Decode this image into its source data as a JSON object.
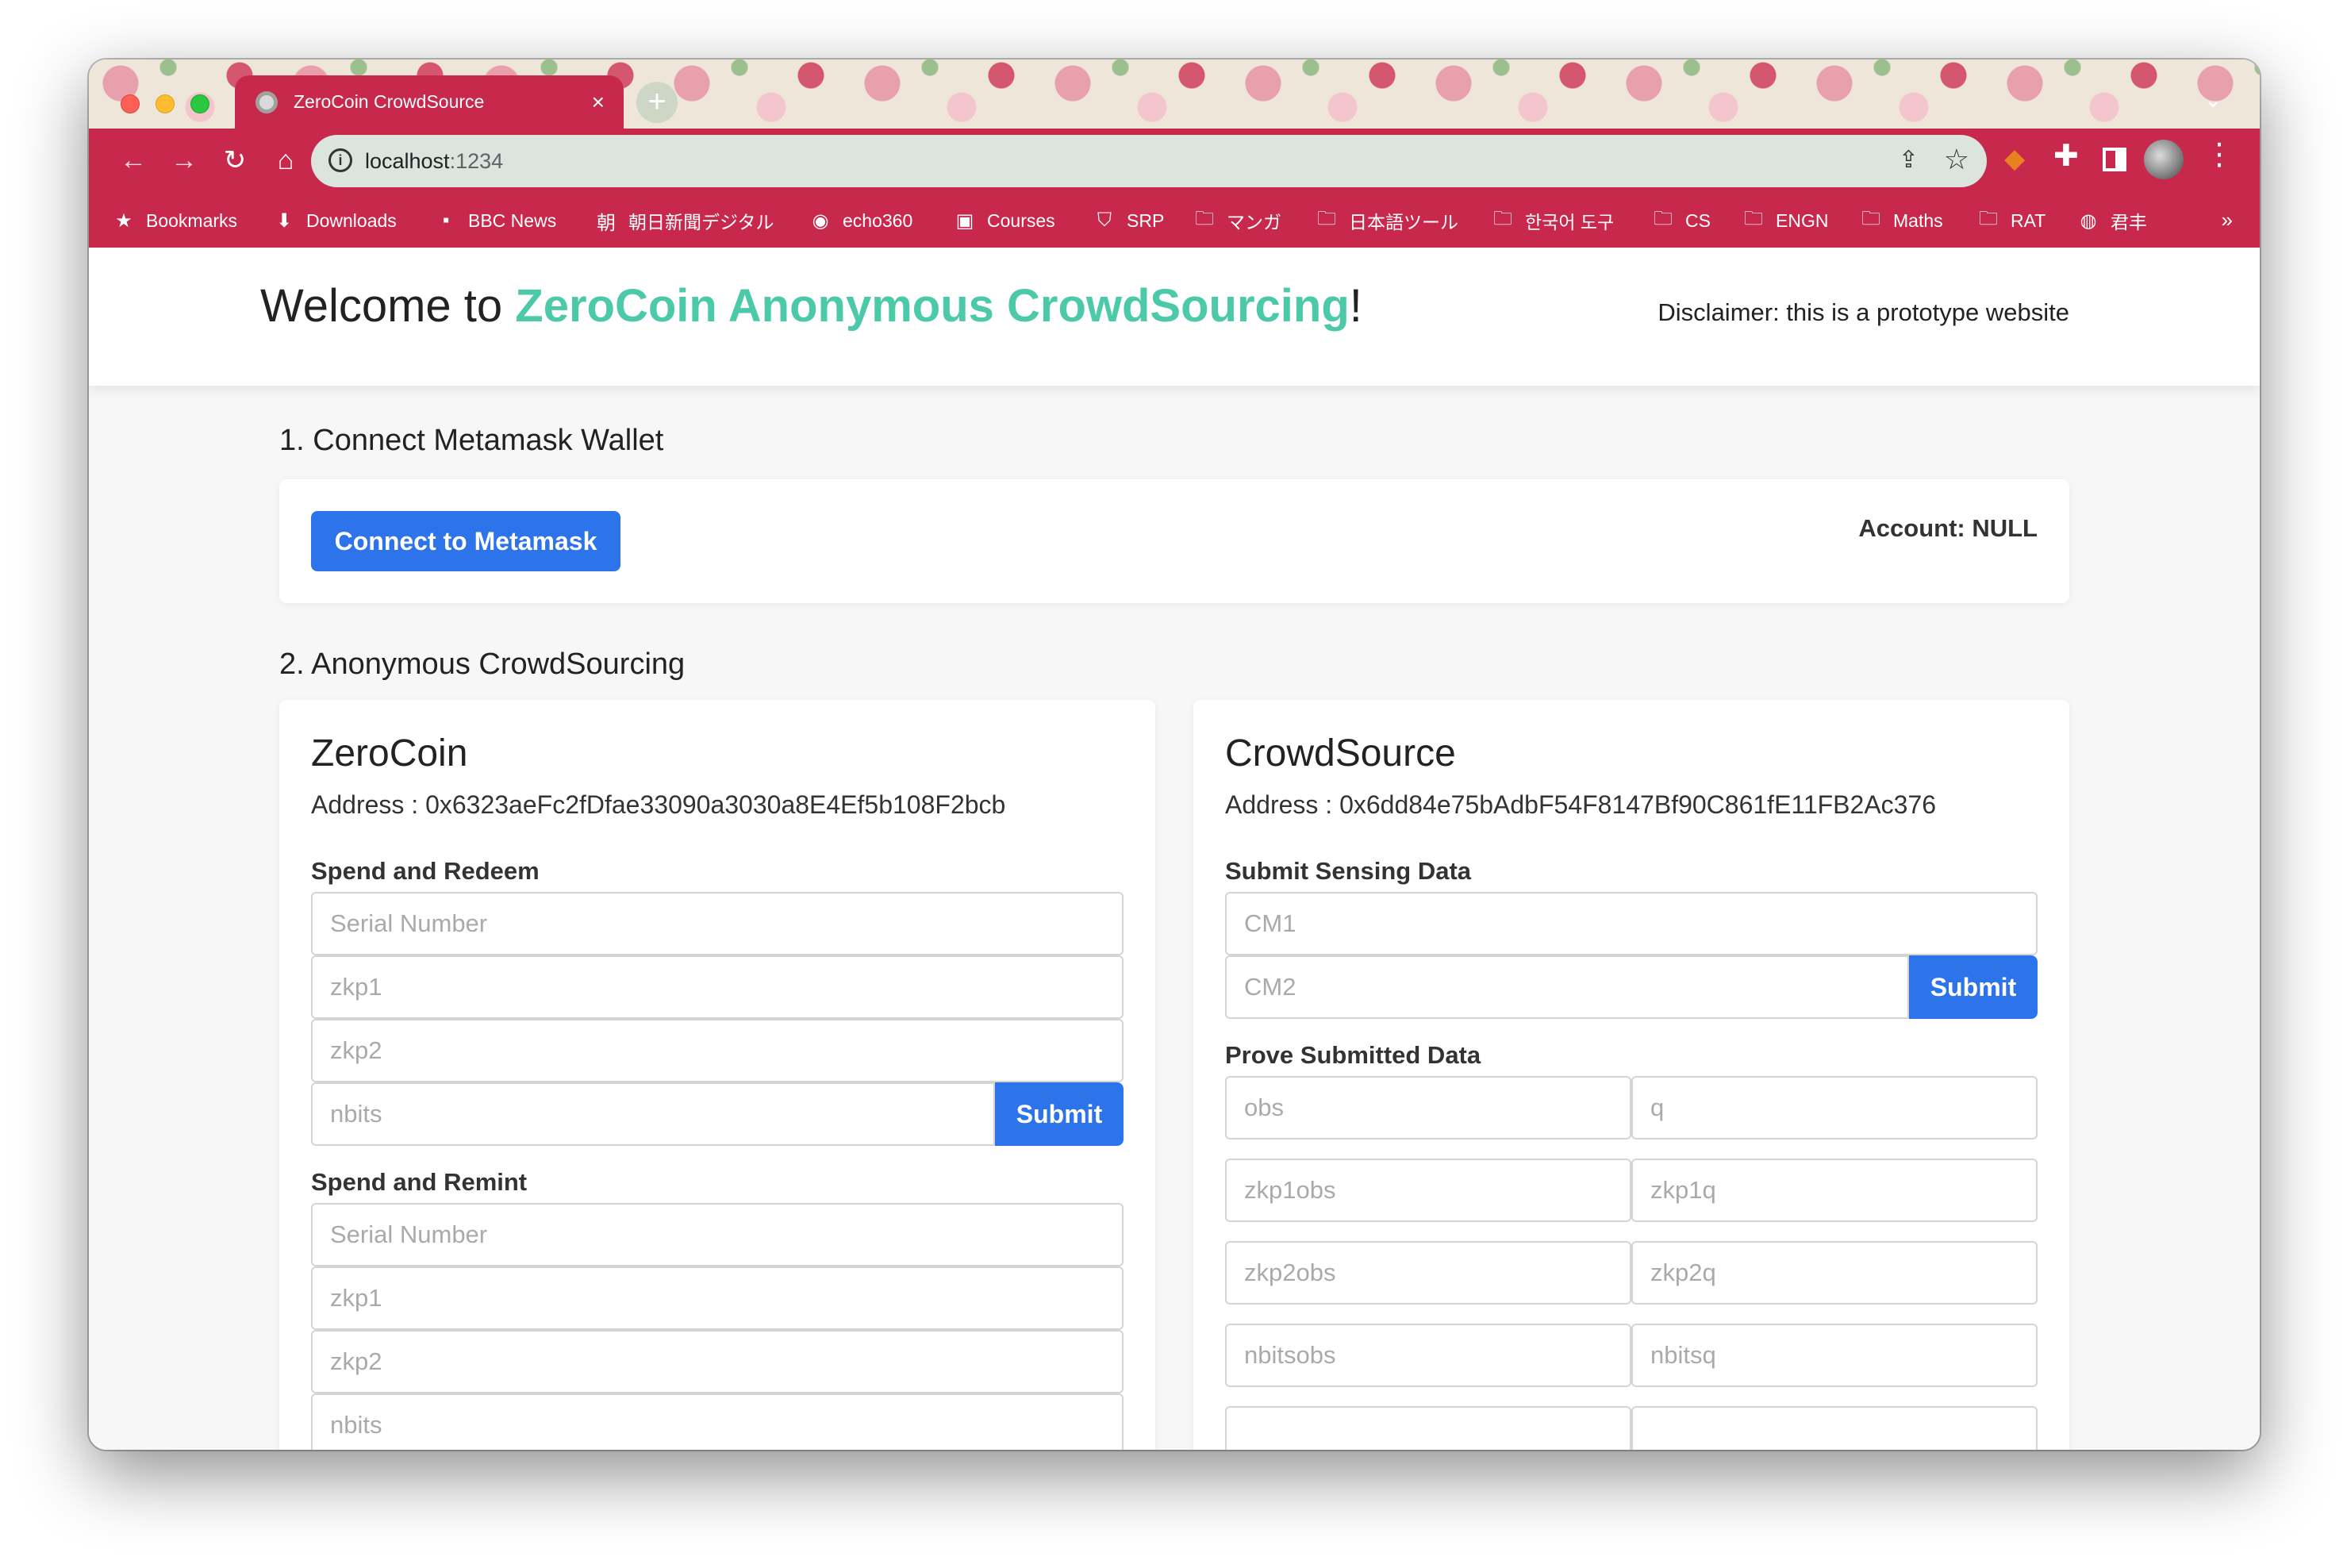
{
  "browser": {
    "tab_title": "ZeroCoin CrowdSource",
    "tab_close": "×",
    "new_tab": "+",
    "url_host": "localhost",
    "url_port": ":1234",
    "more_tabs": "⌄",
    "bookmarks": [
      {
        "label": "Bookmarks",
        "icon": "★"
      },
      {
        "label": "Downloads",
        "icon": "⬇"
      },
      {
        "label": "BBC News",
        "icon": "▪"
      },
      {
        "label": "朝日新聞デジタル",
        "icon": "朝"
      },
      {
        "label": "echo360",
        "icon": "◉"
      },
      {
        "label": "Courses",
        "icon": "▣"
      },
      {
        "label": "SRP",
        "icon": "⛉"
      },
      {
        "label": "マンガ",
        "icon": "🗀"
      },
      {
        "label": "日本語ツール",
        "icon": "🗀"
      },
      {
        "label": "한국어 도구",
        "icon": "🗀"
      },
      {
        "label": "CS",
        "icon": "🗀"
      },
      {
        "label": "ENGN",
        "icon": "🗀"
      },
      {
        "label": "Maths",
        "icon": "🗀"
      },
      {
        "label": "RAT",
        "icon": "🗀"
      },
      {
        "label": "君丰",
        "icon": "◍"
      }
    ],
    "bookmarks_more": "»"
  },
  "header": {
    "welcome_prefix": "Welcome to ",
    "brand": "ZeroCoin Anonymous CrowdSourcing",
    "welcome_suffix": "!",
    "disclaimer": "Disclaimer: this is a prototype website"
  },
  "connect": {
    "heading": "1. Connect Metamask Wallet",
    "button": "Connect to Metamask",
    "account": "Account: NULL"
  },
  "crowdsourcing": {
    "heading": "2. Anonymous CrowdSourcing"
  },
  "zerocoin": {
    "title": "ZeroCoin",
    "address": "Address : 0x6323aeFc2fDfae33090a3030a8E4Ef5b108F2bcb",
    "spend_redeem": {
      "label": "Spend and Redeem",
      "serial_placeholder": "Serial Number",
      "zkp1_placeholder": "zkp1",
      "zkp2_placeholder": "zkp2",
      "nbits_placeholder": "nbits",
      "submit": "Submit"
    },
    "spend_remint": {
      "label": "Spend and Remint",
      "serial_placeholder": "Serial Number",
      "zkp1_placeholder": "zkp1",
      "zkp2_placeholder": "zkp2",
      "nbits_placeholder": "nbits"
    }
  },
  "crowdsource": {
    "title": "CrowdSource",
    "address": "Address : 0x6dd84e75bAdbF54F8147Bf90C861fE11FB2Ac376",
    "submit_sensing": {
      "label": "Submit Sensing Data",
      "cm1_placeholder": "CM1",
      "cm2_placeholder": "CM2",
      "submit": "Submit"
    },
    "prove_submitted": {
      "label": "Prove Submitted Data",
      "obs_placeholder": "obs",
      "q_placeholder": "q",
      "zkp1obs_placeholder": "zkp1obs",
      "zkp1q_placeholder": "zkp1q",
      "zkp2obs_placeholder": "zkp2obs",
      "zkp2q_placeholder": "zkp2q",
      "nbitsobs_placeholder": "nbitsobs",
      "nbitsq_placeholder": "nbitsq"
    }
  },
  "colors": {
    "browser_accent": "#c8284b",
    "brand_green": "#4bc9a8",
    "button_blue": "#2d74ea"
  }
}
